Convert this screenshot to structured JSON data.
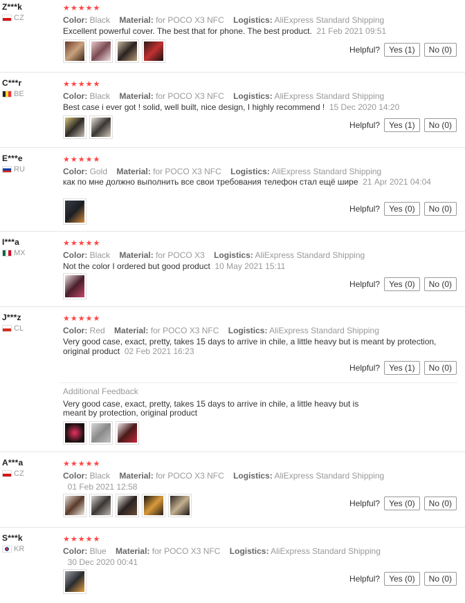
{
  "labels": {
    "color": "Color:",
    "material": "Material:",
    "logistics": "Logistics:",
    "helpful": "Helpful?",
    "additional_feedback": "Additional Feedback"
  },
  "colors": {
    "star": "#ff4747",
    "muted": "#999999"
  },
  "reviews": [
    {
      "user": "Z***k",
      "country": "CZ",
      "stars": "★★★★★",
      "color": "Black",
      "material": "for POCO X3 NFC",
      "logistics": "AliExpress Standard Shipping",
      "text": "Excellent powerful cover. The best that for phone. The best product.",
      "date": "21 Feb 2021 09:51",
      "yes": "Yes (1)",
      "no": "No (0)"
    },
    {
      "user": "C***r",
      "country": "BE",
      "stars": "★★★★★",
      "color": "Black",
      "material": "for POCO X3 NFC",
      "logistics": "AliExpress Standard Shipping",
      "text": "Best case i ever got ! solid, well built, nice design, I highly recommend !",
      "date": "15 Dec 2020 14:20",
      "yes": "Yes (1)",
      "no": "No (0)"
    },
    {
      "user": "E***e",
      "country": "RU",
      "stars": "★★★★★",
      "color": "Gold",
      "material": "for POCO X3 NFC",
      "logistics": "AliExpress Standard Shipping",
      "text": "как по мне должно выполнить все свои требования телефон стал ещё шире",
      "date": "21 Apr 2021 04:04",
      "yes": "Yes (0)",
      "no": "No (0)"
    },
    {
      "user": "I***a",
      "country": "MX",
      "stars": "★★★★★",
      "color": "Black",
      "material": "for POCO X3",
      "logistics": "AliExpress Standard Shipping",
      "text": "Not the color I ordered but good product",
      "date": "10 May 2021 15:11",
      "yes": "Yes (0)",
      "no": "No (0)"
    },
    {
      "user": "J***z",
      "country": "CL",
      "stars": "★★★★★",
      "color": "Red",
      "material": "for POCO X3 NFC",
      "logistics": "AliExpress Standard Shipping",
      "text": "Very good case, exact, pretty, takes 15 days to arrive in chile, a little heavy but is meant by protection, original product",
      "date": "02 Feb 2021 16:23",
      "yes": "Yes (1)",
      "no": "No (0)",
      "additional": "Very good case, exact, pretty, takes 15 days to arrive in chile, a little heavy but is meant by protection, original product"
    },
    {
      "user": "A***a",
      "country": "CZ",
      "stars": "★★★★★",
      "color": "Black",
      "material": "for POCO X3 NFC",
      "logistics": "AliExpress Standard Shipping",
      "text": "",
      "date": "01 Feb 2021 12:58",
      "yes": "Yes (0)",
      "no": "No (0)"
    },
    {
      "user": "S***k",
      "country": "KR",
      "stars": "★★★★★",
      "color": "Blue",
      "material": "for POCO X3 NFC",
      "logistics": "AliExpress Standard Shipping",
      "text": "",
      "date": "30 Dec 2020 00:41",
      "yes": "Yes (0)",
      "no": "No (0)"
    }
  ]
}
